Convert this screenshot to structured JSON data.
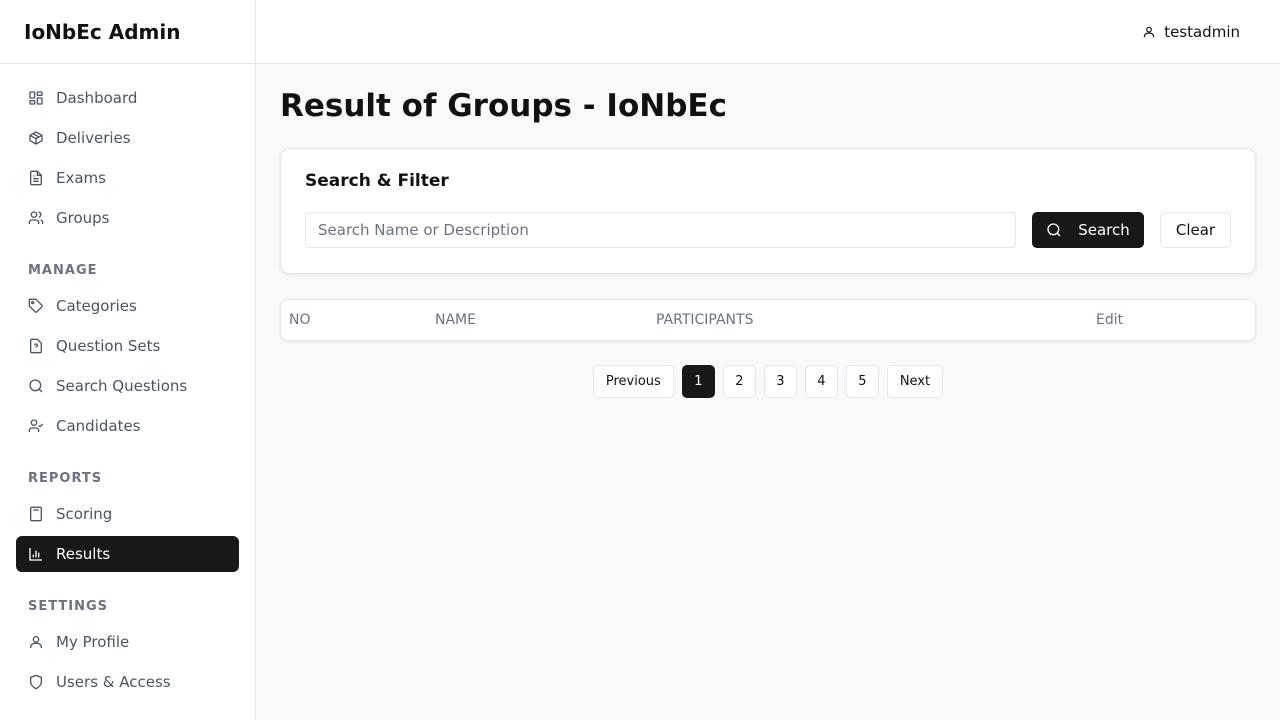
{
  "app": {
    "title": "IoNbEc Admin"
  },
  "header": {
    "username": "testadmin"
  },
  "sidebar": {
    "main_items": [
      {
        "label": "Dashboard",
        "icon": "dashboard-icon"
      },
      {
        "label": "Deliveries",
        "icon": "package-icon"
      },
      {
        "label": "Exams",
        "icon": "document-icon"
      },
      {
        "label": "Groups",
        "icon": "users-icon"
      }
    ],
    "manage_label": "MANAGE",
    "manage_items": [
      {
        "label": "Categories",
        "icon": "tag-icon"
      },
      {
        "label": "Question Sets",
        "icon": "question-file-icon"
      },
      {
        "label": "Search Questions",
        "icon": "search-icon"
      },
      {
        "label": "Candidates",
        "icon": "user-check-icon"
      }
    ],
    "reports_label": "REPORTS",
    "reports_items": [
      {
        "label": "Scoring",
        "icon": "calculator-icon"
      },
      {
        "label": "Results",
        "icon": "bar-chart-icon",
        "active": true
      }
    ],
    "settings_label": "SETTINGS",
    "settings_items": [
      {
        "label": "My Profile",
        "icon": "user-icon"
      },
      {
        "label": "Users & Access",
        "icon": "shield-icon"
      }
    ]
  },
  "main": {
    "title": "Result of Groups - IoNbEc",
    "filter": {
      "title": "Search & Filter",
      "search_placeholder": "Search Name or Description",
      "search_value": "",
      "search_button": "Search",
      "clear_button": "Clear"
    },
    "table": {
      "columns": [
        "NO",
        "NAME",
        "PARTICIPANTS",
        "Edit"
      ],
      "rows": []
    },
    "pagination": {
      "previous": "Previous",
      "pages": [
        "1",
        "2",
        "3",
        "4",
        "5"
      ],
      "current": "1",
      "next": "Next"
    }
  },
  "colors": {
    "accent": "#18181b",
    "background": "#f8f9fb",
    "border": "#e5e7eb",
    "muted": "#6b7280"
  }
}
